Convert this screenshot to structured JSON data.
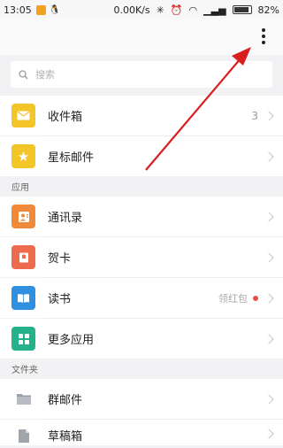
{
  "status_bar": {
    "time": "13:05",
    "network_speed": "0.00K/s",
    "battery": "82%",
    "battery_level": 0.82
  },
  "search": {
    "placeholder": "搜索"
  },
  "inbox": {
    "label": "收件箱",
    "count": "3"
  },
  "starred": {
    "label": "星标邮件"
  },
  "sections": {
    "apps": "应用",
    "folders": "文件夹"
  },
  "apps": {
    "contacts": "通讯录",
    "cards": "贺卡",
    "reading": "读书",
    "reading_hint": "领红包",
    "more": "更多应用"
  },
  "folders": {
    "group_mail": "群邮件",
    "drafts": "草稿箱"
  },
  "colors": {
    "inbox_tile": "#f4c528",
    "starred_tile": "#f4c528",
    "contacts_tile": "#f08a3a",
    "cards_tile": "#ee6b4d",
    "reading_tile": "#2f8fe0",
    "more_tile": "#23b28b",
    "folder_tile": "#e3e3e5",
    "annotation_arrow": "#d81e1e"
  }
}
